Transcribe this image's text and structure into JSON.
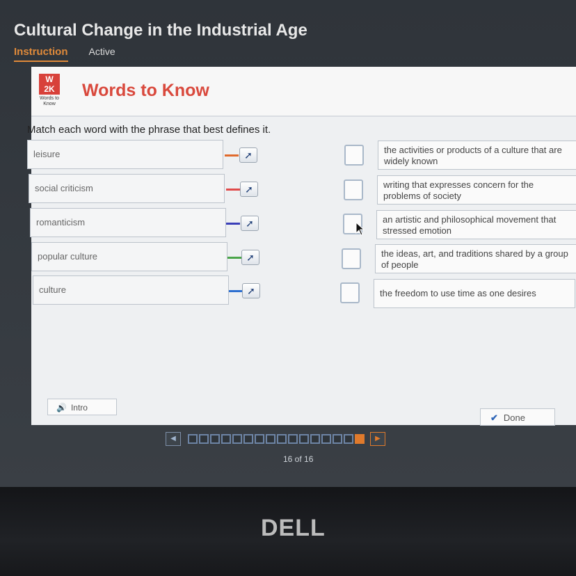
{
  "app": {
    "title": "Cultural Change in the Industrial Age",
    "tabs": [
      {
        "label": "Instruction",
        "state": "active"
      },
      {
        "label": "Active",
        "state": "status"
      }
    ]
  },
  "activity": {
    "logo_text": "W 2K",
    "logo_caption": "Words to Know",
    "header_title": "Words to Know",
    "instruction": "Match each word with the phrase that best defines it.",
    "words": [
      {
        "label": "leisure",
        "connector_color": "#e06a2c"
      },
      {
        "label": "social criticism",
        "connector_color": "#e04a4a"
      },
      {
        "label": "romanticism",
        "connector_color": "#3a3fb8"
      },
      {
        "label": "popular culture",
        "connector_color": "#4aa54a"
      },
      {
        "label": "culture",
        "connector_color": "#2d6fd0"
      }
    ],
    "definitions": [
      "the activities or products of a culture that are widely known",
      "writing that expresses concern for the problems of society",
      "an artistic and philosophical movement that stressed emotion",
      "the ideas, art, and traditions shared by a group of people",
      "the freedom to use time as one desires"
    ],
    "intro_label": "Intro",
    "done_label": "Done"
  },
  "pager": {
    "total": 16,
    "current": 16,
    "label": "16 of 16"
  },
  "bezel": {
    "brand": "DELL"
  },
  "colors": {
    "accent": "#e08a3a",
    "header_red": "#d9493d"
  }
}
